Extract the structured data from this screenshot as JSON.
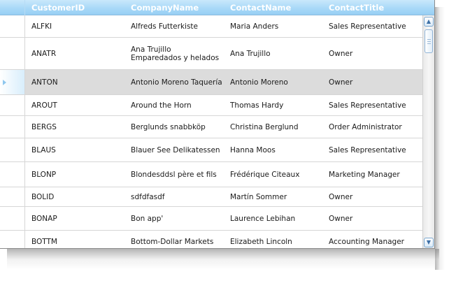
{
  "columns": [
    "CustomerID",
    "CompanyName",
    "ContactName",
    "ContactTitle"
  ],
  "rows": [
    {
      "id": "ALFKI",
      "company": "Alfreds Futterkiste",
      "contact": "Maria Anders",
      "title": "Sales Representative"
    },
    {
      "id": "ANATR",
      "company": "Ana Trujillo Emparedados y helados",
      "contact": "Ana Trujillo",
      "title": "Owner"
    },
    {
      "id": "ANTON",
      "company": "Antonio Moreno Taquería",
      "contact": "Antonio Moreno",
      "title": "Owner"
    },
    {
      "id": "AROUT",
      "company": "Around the Horn",
      "contact": "Thomas Hardy",
      "title": "Sales Representative"
    },
    {
      "id": "BERGS",
      "company": "Berglunds snabbköp",
      "contact": "Christina Berglund",
      "title": "Order Administrator"
    },
    {
      "id": "BLAUS",
      "company": "Blauer See Delikatessen",
      "contact": "Hanna Moos",
      "title": "Sales Representative"
    },
    {
      "id": "BLONP",
      "company": "Blondesddsl père et fils",
      "contact": "Frédérique Citeaux",
      "title": "Marketing Manager"
    },
    {
      "id": "BOLID",
      "company": "sdfdfasdf",
      "contact": "Martín Sommer",
      "title": "Owner"
    },
    {
      "id": "BONAP",
      "company": "Bon app'",
      "contact": "Laurence Lebihan",
      "title": "Owner"
    },
    {
      "id": "BOTTM",
      "company": "Bottom-Dollar Markets",
      "contact": "Elizabeth Lincoln",
      "title": "Accounting Manager"
    }
  ],
  "selected_row_index": 2,
  "scrollbar": {
    "up_icon": "arrow-up-icon",
    "down_icon": "arrow-down-icon"
  },
  "colors": {
    "header_top": "#c9e8fb",
    "header_bottom": "#97cff4",
    "header_text": "#ffffff",
    "selected_row": "#dcdcdc",
    "row_indicator": "#8fc7ee"
  }
}
